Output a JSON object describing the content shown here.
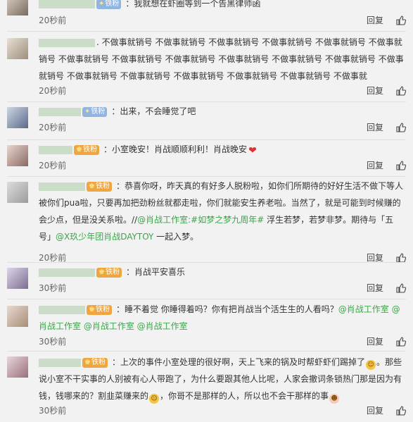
{
  "comments": [
    {
      "text": "：我就想在虾圈等到一个告黑律师函",
      "badge": "铁粉",
      "time": "20秒前",
      "reply": "回复"
    },
    {
      "text": ". 不做事就销号 不做事就销号 不做事就销号 不做事就销号 不做事就销号 不做事就销号 不做事就销号 不做事就销号 不做事就销号 不做事就销号 不做事就销号 不做事就销号 不做事就销号 不做事就销号 不做事就销号 不做事就销号 不做事就销号 不做事就销号 不做事就",
      "time": "20秒前",
      "reply": "回复"
    },
    {
      "badge": "铁粉",
      "text": "：出来，不会睡觉了吧",
      "time": "20秒前",
      "reply": "回复"
    },
    {
      "badge": "铁粉",
      "text": "：小室晚安！肖战顺顺利利！肖战晚安",
      "time": "20秒前",
      "reply": "回复"
    },
    {
      "badge": "铁粉",
      "text": "：恭喜你呀，昨天真的有好多人脱粉啦，如你们所期待的好好生活不做下等人被你们pua啦，只要再加把劲粉丝就都走啦，你们就能安生养老啦。当然了，就是可能到时候赚的会少点，但是没关系啦。//",
      "link1": "@肖战工作室:#如梦之梦九周年#",
      "text2": " 浮生若梦，若梦非梦。期待与「五号」",
      "link2": "@X玖少年团肖战DAYTOY",
      "text3": " 一起入梦。",
      "time": "20秒前",
      "reply": "回复"
    },
    {
      "badge": "铁粉",
      "text": "：肖战平安喜乐",
      "time": "30秒前",
      "reply": "回复"
    },
    {
      "badge": "铁粉",
      "text": "：睡不着觉 你睡得着吗？你有把肖战当个活生生的人看吗？",
      "link1": "@肖战工作室 @肖战工作室 @肖战工作室 @肖战工作室",
      "time": "30秒前",
      "reply": "回复"
    },
    {
      "badge": "铁粉",
      "text": "：上次的事件小室处理的很好啊，天上飞来的锅及时帮虾虾们踢掉了",
      "text2": "。那些说小室不干实事的人别被有心人带跑了，为什么要跟其他人比呢，人家会撤词条锁热门那是因为有钱，钱哪来的？割韭菜赚来的",
      "text3": "，你哥不是那样的人，所以也不会干那样的事",
      "time": "30秒前",
      "reply": "回复"
    }
  ]
}
